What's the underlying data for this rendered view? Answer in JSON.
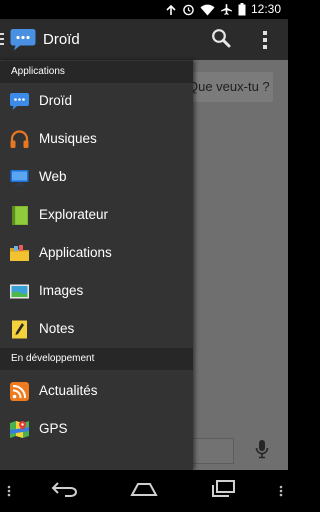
{
  "app": {
    "title": "Droïd"
  },
  "status_bar": {
    "time": "12:30"
  },
  "drawer": {
    "sections": [
      {
        "title": "Applications"
      },
      {
        "title": "En développement"
      }
    ],
    "items": [
      {
        "label": "Droïd",
        "icon": "speech-bubble-icon",
        "color": "#3d8be8"
      },
      {
        "label": "Musiques",
        "icon": "headphones-icon",
        "color": "#e87722"
      },
      {
        "label": "Web",
        "icon": "monitor-icon",
        "color": "#1e6fd8"
      },
      {
        "label": "Explorateur",
        "icon": "book-icon",
        "color": "#7db830"
      },
      {
        "label": "Applications",
        "icon": "folder-icon",
        "color": "#f2c230"
      },
      {
        "label": "Images",
        "icon": "landscape-image-icon",
        "color": "#3aa0d8"
      },
      {
        "label": "Notes",
        "icon": "note-pencil-icon",
        "color": "#f4d23c"
      },
      {
        "label": "Actualités",
        "icon": "rss-icon",
        "color": "#f07b1f"
      },
      {
        "label": "GPS",
        "icon": "map-pin-icon",
        "color": "#3a7de0"
      }
    ]
  },
  "chat": {
    "bubble_text": "Que veux-tu ?"
  },
  "colors": {
    "action_bar": "#2b2b2b",
    "drawer_bg": "#333333",
    "section_header_bg": "#272727",
    "overlay": "#6f6f6f"
  }
}
